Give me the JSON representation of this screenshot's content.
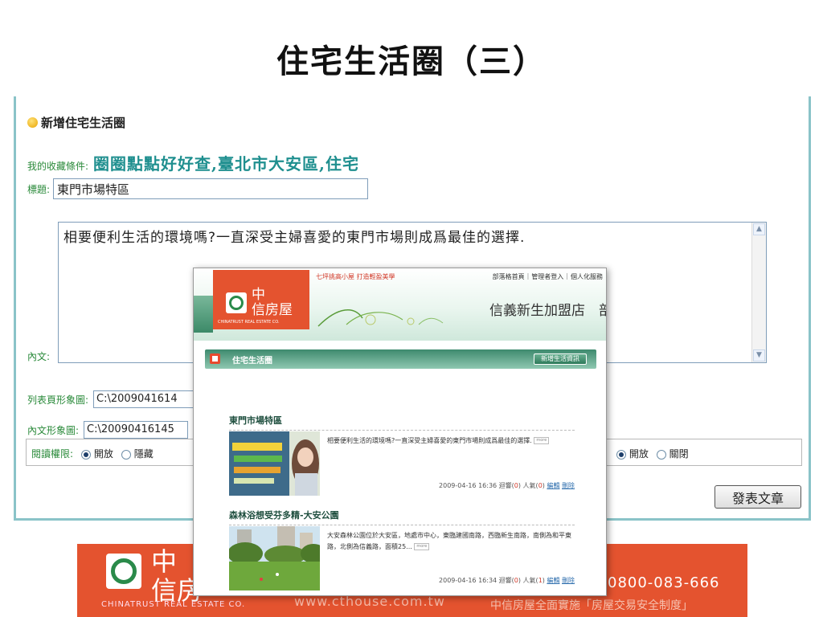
{
  "slide_title": "住宅生活圈（三）",
  "form": {
    "heading": "新增住宅生活圈",
    "fav_label": "我的收藏條件:",
    "fav_value": "圈圈點點好好查,臺北市大安區,住宅",
    "title_label": "標題:",
    "title_value": "東門市場特區",
    "content_label": "內文:",
    "content_value": "相要便利生活的環境嗎?一直深受主婦喜愛的東門市場則成爲最佳的選擇.",
    "list_img_label": "列表頁形象圖:",
    "list_img_value": "C:\\2009041614",
    "content_img_label": "內文形象圖:",
    "content_img_value": "C:\\20090416145",
    "perm_label": "閱讀權限:",
    "perm_open": "開放",
    "perm_hide": "隱藏",
    "perm2_open": "開放",
    "perm2_close": "關閉",
    "publish_label": "發表文章",
    "scroll_up": "▲",
    "scroll_down": "▼"
  },
  "popup": {
    "promo": "七坪挑高小屋 打造輕盈美學",
    "nav": [
      "部落格首頁",
      "管理者登入",
      "個人化服務"
    ],
    "logo_zh_1": "中",
    "logo_zh_2": "信房屋",
    "logo_en": "CHINATRUST REAL ESTATE CO.",
    "store_name": "信義新生加盟店　部",
    "section_title": "住宅生活圈",
    "new_btn": "新增生活資訊",
    "posts": [
      {
        "title": "東門市場特區",
        "desc": "相要便利生活的環境嗎?一直深受主婦喜愛的東門市場則成爲最佳的選擇.",
        "more": "more",
        "date": "2009-04-16 16:36",
        "reply_label": "迴響(",
        "reply_count": "0",
        "pop_label": ") 人氣(",
        "pop_count": "0",
        "pop_end": ")",
        "edit": "編輯",
        "delete": "刪除"
      },
      {
        "title": "森林浴想受芬多精-大安公園",
        "desc": "大安森林公園位於大安區，地處市中心，東臨建國南路，西臨新生南路，南側為和平東路，北側為信義路，面積25...",
        "more": "more",
        "date": "2009-04-16 16:34",
        "reply_label": "迴響(",
        "reply_count": "0",
        "pop_label": ") 人氣(",
        "pop_count": "1",
        "pop_end": ")",
        "edit": "編輯",
        "delete": "刪除"
      }
    ]
  },
  "banner": {
    "zh": "中\n信房",
    "en": "CHINATRUST REAL ESTATE CO.",
    "url": "www.cthouse.com.tw",
    "phone": "0800-083-666",
    "slogan": "中信房屋全面實施「房屋交易安全制度」"
  },
  "colors": {
    "accent": "#e4532f",
    "teal": "#1f8f8f",
    "green_label": "#2a8a3a"
  }
}
